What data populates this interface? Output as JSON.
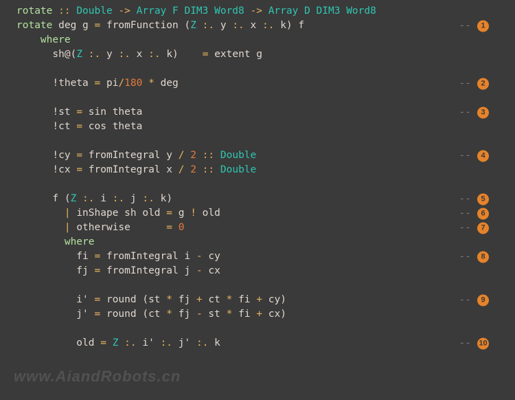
{
  "lines": [
    {
      "segments": [
        {
          "t": "rotate ",
          "c": "kw"
        },
        {
          "t": ":: ",
          "c": "op"
        },
        {
          "t": "Double ",
          "c": "ty"
        },
        {
          "t": "-> ",
          "c": "op"
        },
        {
          "t": "Array F DIM3 Word8 ",
          "c": "ty"
        },
        {
          "t": "-> ",
          "c": "op"
        },
        {
          "t": "Array D DIM3 Word8",
          "c": "ty"
        }
      ],
      "badge": null
    },
    {
      "segments": [
        {
          "t": "rotate ",
          "c": "kw"
        },
        {
          "t": "deg g ",
          "c": "txt"
        },
        {
          "t": "= ",
          "c": "op"
        },
        {
          "t": "fromFunction (",
          "c": "txt"
        },
        {
          "t": "Z ",
          "c": "ty"
        },
        {
          "t": ":. ",
          "c": "op"
        },
        {
          "t": "y ",
          "c": "txt"
        },
        {
          "t": ":. ",
          "c": "op"
        },
        {
          "t": "x ",
          "c": "txt"
        },
        {
          "t": ":. ",
          "c": "op"
        },
        {
          "t": "k) f",
          "c": "txt"
        }
      ],
      "badge": "1"
    },
    {
      "segments": [
        {
          "t": "    ",
          "c": "txt"
        },
        {
          "t": "where",
          "c": "kw"
        }
      ],
      "badge": null
    },
    {
      "segments": [
        {
          "t": "      sh@(",
          "c": "txt"
        },
        {
          "t": "Z ",
          "c": "ty"
        },
        {
          "t": ":. ",
          "c": "op"
        },
        {
          "t": "y ",
          "c": "txt"
        },
        {
          "t": ":. ",
          "c": "op"
        },
        {
          "t": "x ",
          "c": "txt"
        },
        {
          "t": ":. ",
          "c": "op"
        },
        {
          "t": "k)    ",
          "c": "txt"
        },
        {
          "t": "= ",
          "c": "op"
        },
        {
          "t": "extent g",
          "c": "txt"
        }
      ],
      "badge": null
    },
    {
      "segments": [
        {
          "t": " ",
          "c": "txt"
        }
      ],
      "badge": null
    },
    {
      "segments": [
        {
          "t": "      !theta ",
          "c": "txt"
        },
        {
          "t": "= ",
          "c": "op"
        },
        {
          "t": "pi",
          "c": "txt"
        },
        {
          "t": "/",
          "c": "op"
        },
        {
          "t": "180 ",
          "c": "num"
        },
        {
          "t": "* ",
          "c": "op"
        },
        {
          "t": "deg",
          "c": "txt"
        }
      ],
      "badge": "2"
    },
    {
      "segments": [
        {
          "t": " ",
          "c": "txt"
        }
      ],
      "badge": null
    },
    {
      "segments": [
        {
          "t": "      !st ",
          "c": "txt"
        },
        {
          "t": "= ",
          "c": "op"
        },
        {
          "t": "sin theta",
          "c": "txt"
        }
      ],
      "badge": "3"
    },
    {
      "segments": [
        {
          "t": "      !ct ",
          "c": "txt"
        },
        {
          "t": "= ",
          "c": "op"
        },
        {
          "t": "cos theta",
          "c": "txt"
        }
      ],
      "badge": null
    },
    {
      "segments": [
        {
          "t": " ",
          "c": "txt"
        }
      ],
      "badge": null
    },
    {
      "segments": [
        {
          "t": "      !cy ",
          "c": "txt"
        },
        {
          "t": "= ",
          "c": "op"
        },
        {
          "t": "fromIntegral y ",
          "c": "txt"
        },
        {
          "t": "/ ",
          "c": "op"
        },
        {
          "t": "2 ",
          "c": "num"
        },
        {
          "t": ":: ",
          "c": "op"
        },
        {
          "t": "Double",
          "c": "ty"
        }
      ],
      "badge": "4"
    },
    {
      "segments": [
        {
          "t": "      !cx ",
          "c": "txt"
        },
        {
          "t": "= ",
          "c": "op"
        },
        {
          "t": "fromIntegral x ",
          "c": "txt"
        },
        {
          "t": "/ ",
          "c": "op"
        },
        {
          "t": "2 ",
          "c": "num"
        },
        {
          "t": ":: ",
          "c": "op"
        },
        {
          "t": "Double",
          "c": "ty"
        }
      ],
      "badge": null
    },
    {
      "segments": [
        {
          "t": " ",
          "c": "txt"
        }
      ],
      "badge": null
    },
    {
      "segments": [
        {
          "t": "      f (",
          "c": "txt"
        },
        {
          "t": "Z ",
          "c": "ty"
        },
        {
          "t": ":. ",
          "c": "op"
        },
        {
          "t": "i ",
          "c": "txt"
        },
        {
          "t": ":. ",
          "c": "op"
        },
        {
          "t": "j ",
          "c": "txt"
        },
        {
          "t": ":. ",
          "c": "op"
        },
        {
          "t": "k)",
          "c": "txt"
        }
      ],
      "badge": "5"
    },
    {
      "segments": [
        {
          "t": "        ",
          "c": "txt"
        },
        {
          "t": "| ",
          "c": "op"
        },
        {
          "t": "inShape sh old ",
          "c": "txt"
        },
        {
          "t": "= ",
          "c": "op"
        },
        {
          "t": "g ",
          "c": "txt"
        },
        {
          "t": "! ",
          "c": "op"
        },
        {
          "t": "old",
          "c": "txt"
        }
      ],
      "badge": "6"
    },
    {
      "segments": [
        {
          "t": "        ",
          "c": "txt"
        },
        {
          "t": "| ",
          "c": "op"
        },
        {
          "t": "otherwise      ",
          "c": "txt"
        },
        {
          "t": "= ",
          "c": "op"
        },
        {
          "t": "0",
          "c": "num"
        }
      ],
      "badge": "7"
    },
    {
      "segments": [
        {
          "t": "        ",
          "c": "txt"
        },
        {
          "t": "where",
          "c": "kw"
        }
      ],
      "badge": null
    },
    {
      "segments": [
        {
          "t": "          fi ",
          "c": "txt"
        },
        {
          "t": "= ",
          "c": "op"
        },
        {
          "t": "fromIntegral i ",
          "c": "txt"
        },
        {
          "t": "- ",
          "c": "op"
        },
        {
          "t": "cy",
          "c": "txt"
        }
      ],
      "badge": "8"
    },
    {
      "segments": [
        {
          "t": "          fj ",
          "c": "txt"
        },
        {
          "t": "= ",
          "c": "op"
        },
        {
          "t": "fromIntegral j ",
          "c": "txt"
        },
        {
          "t": "- ",
          "c": "op"
        },
        {
          "t": "cx",
          "c": "txt"
        }
      ],
      "badge": null
    },
    {
      "segments": [
        {
          "t": " ",
          "c": "txt"
        }
      ],
      "badge": null
    },
    {
      "segments": [
        {
          "t": "          i' ",
          "c": "txt"
        },
        {
          "t": "= ",
          "c": "op"
        },
        {
          "t": "round (st ",
          "c": "txt"
        },
        {
          "t": "* ",
          "c": "op"
        },
        {
          "t": "fj ",
          "c": "txt"
        },
        {
          "t": "+ ",
          "c": "op"
        },
        {
          "t": "ct ",
          "c": "txt"
        },
        {
          "t": "* ",
          "c": "op"
        },
        {
          "t": "fi ",
          "c": "txt"
        },
        {
          "t": "+ ",
          "c": "op"
        },
        {
          "t": "cy)",
          "c": "txt"
        }
      ],
      "badge": "9"
    },
    {
      "segments": [
        {
          "t": "          j' ",
          "c": "txt"
        },
        {
          "t": "= ",
          "c": "op"
        },
        {
          "t": "round (ct ",
          "c": "txt"
        },
        {
          "t": "* ",
          "c": "op"
        },
        {
          "t": "fj ",
          "c": "txt"
        },
        {
          "t": "- ",
          "c": "op"
        },
        {
          "t": "st ",
          "c": "txt"
        },
        {
          "t": "* ",
          "c": "op"
        },
        {
          "t": "fi ",
          "c": "txt"
        },
        {
          "t": "+ ",
          "c": "op"
        },
        {
          "t": "cx)",
          "c": "txt"
        }
      ],
      "badge": null
    },
    {
      "segments": [
        {
          "t": " ",
          "c": "txt"
        }
      ],
      "badge": null
    },
    {
      "segments": [
        {
          "t": "          old ",
          "c": "txt"
        },
        {
          "t": "= ",
          "c": "op"
        },
        {
          "t": "Z ",
          "c": "ty"
        },
        {
          "t": ":. ",
          "c": "op"
        },
        {
          "t": "i' ",
          "c": "txt"
        },
        {
          "t": ":. ",
          "c": "op"
        },
        {
          "t": "j' ",
          "c": "txt"
        },
        {
          "t": ":. ",
          "c": "op"
        },
        {
          "t": "k",
          "c": "txt"
        }
      ],
      "badge": "10"
    }
  ],
  "dash": "--",
  "watermark": "www.AiandRobots.cn"
}
